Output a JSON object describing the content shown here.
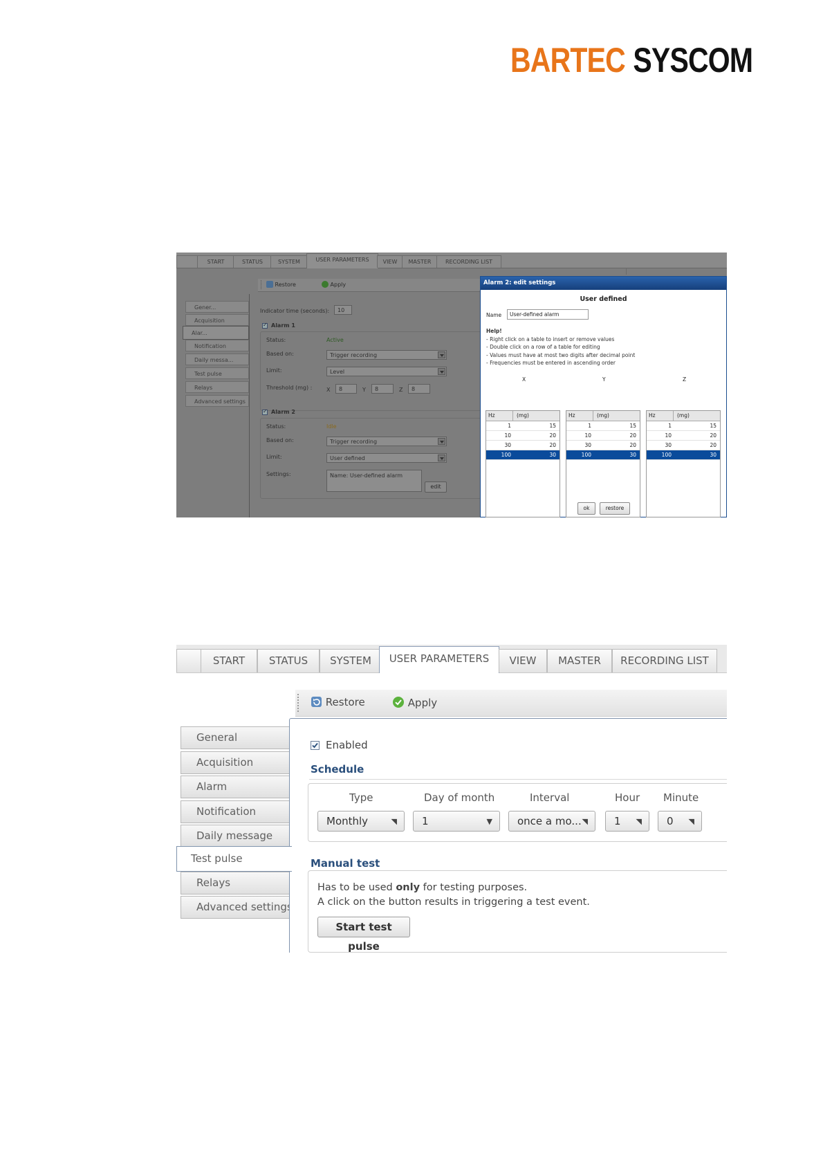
{
  "logo": {
    "part1": "BARTEC",
    "part2": "SYSCOM",
    "color_primary": "#e8751a",
    "color_secondary": "#111111"
  },
  "shot1": {
    "tabs": [
      "",
      "START",
      "STATUS",
      "SYSTEM",
      "USER PARAMETERS",
      "VIEW",
      "MASTER",
      "RECORDING LIST"
    ],
    "active_tab": "USER PARAMETERS",
    "toolbar": {
      "restore": "Restore",
      "apply": "Apply"
    },
    "nav": [
      "Gener...",
      "Acquisition",
      "Alar...",
      "Notification",
      "Daily messa...",
      "Test pulse",
      "Relays",
      "Advanced settings"
    ],
    "active_nav": "Alar...",
    "indicator_label": "Indicator time (seconds):",
    "indicator_value": "10",
    "alarm1": {
      "title": "Alarm 1",
      "status_label": "Status:",
      "status_value": "Active",
      "status_color": "#3a6b2b",
      "based_label": "Based on:",
      "based_value": "Trigger recording",
      "limit_label": "Limit:",
      "limit_value": "Level",
      "threshold_label": "Threshold (mg) :",
      "x_label": "X",
      "x_value": "8",
      "y_label": "Y",
      "y_value": "8",
      "z_label": "Z",
      "z_value": "8"
    },
    "alarm2": {
      "title": "Alarm 2",
      "status_label": "Status:",
      "status_value": "Idle",
      "status_color": "#8a6a1e",
      "based_label": "Based on:",
      "based_value": "Trigger recording",
      "limit_label": "Limit:",
      "limit_value": "User defined",
      "settings_label": "Settings:",
      "settings_value": "Name: User-defined alarm",
      "edit_label": "edit"
    },
    "dialog": {
      "title": "Alarm 2: edit settings",
      "heading": "User defined",
      "name_label": "Name",
      "name_value": "User-defined alarm",
      "help_title": "Help!",
      "help_lines": [
        "- Right click on a table to insert or remove values",
        "- Double click on a row of a table for editing",
        "- Values must have at most two digits after decimal point",
        "- Frequencies must be entered in ascending order"
      ],
      "axis_labels": [
        "X",
        "Y",
        "Z"
      ],
      "col_hz": "Hz",
      "col_mg": "(mg)",
      "tables": {
        "x": [
          [
            "1",
            "15"
          ],
          [
            "10",
            "20"
          ],
          [
            "30",
            "20"
          ],
          [
            "100",
            "30"
          ]
        ],
        "y": [
          [
            "1",
            "15"
          ],
          [
            "10",
            "20"
          ],
          [
            "30",
            "20"
          ],
          [
            "100",
            "30"
          ]
        ],
        "z": [
          [
            "1",
            "15"
          ],
          [
            "10",
            "20"
          ],
          [
            "30",
            "20"
          ],
          [
            "100",
            "30"
          ]
        ]
      },
      "ok_label": "ok",
      "restore_label": "restore"
    }
  },
  "shot2": {
    "tabs": [
      "",
      "START",
      "STATUS",
      "SYSTEM",
      "USER PARAMETERS",
      "VIEW",
      "MASTER",
      "RECORDING LIST"
    ],
    "active_tab": "USER PARAMETERS",
    "toolbar": {
      "restore": "Restore",
      "apply": "Apply"
    },
    "nav": [
      "General",
      "Acquisition",
      "Alarm",
      "Notification",
      "Daily message",
      "Test pulse",
      "Relays",
      "Advanced settings"
    ],
    "active_nav": "Test pulse",
    "enabled_label": "Enabled",
    "schedule_title": "Schedule",
    "schedule_columns": [
      "Type",
      "Day of month",
      "Interval",
      "Hour",
      "Minute"
    ],
    "schedule_values": [
      "Monthly",
      "1",
      "once a mo...",
      "1",
      "0"
    ],
    "manual_title": "Manual test",
    "manual_line1_pre": "Has to be used ",
    "manual_line1_bold": "only",
    "manual_line1_post": " for testing purposes.",
    "manual_line2": "A click on the button results in triggering a test event.",
    "start_button": "Start test pulse",
    "accent_color": "#2a4f7c"
  }
}
